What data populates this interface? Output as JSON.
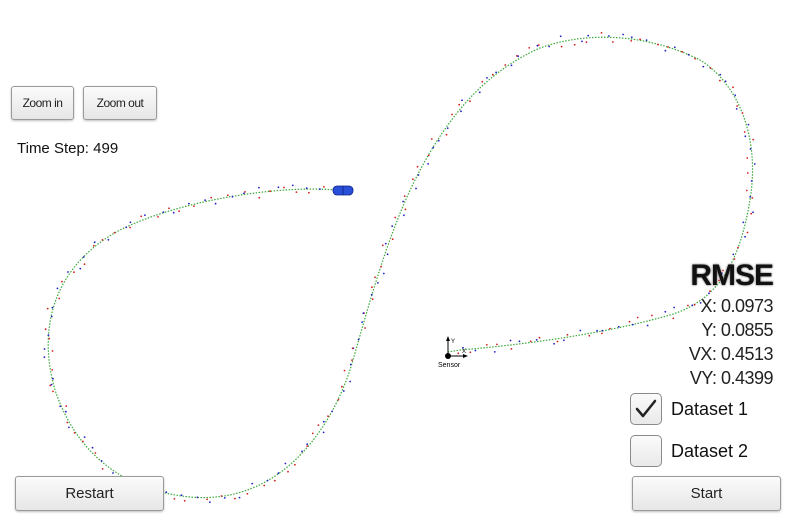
{
  "controls": {
    "zoom_in_label": "Zoom in",
    "zoom_out_label": "Zoom out",
    "restart_label": "Restart",
    "start_label": "Start"
  },
  "status": {
    "time_step_label": "Time Step: 499"
  },
  "rmse": {
    "title": "RMSE",
    "x": "X: 0.0973",
    "y": "Y: 0.0855",
    "vx": "VX: 0.4513",
    "vy": "VY: 0.4399"
  },
  "datasets": [
    {
      "label": "Dataset 1",
      "checked": true
    },
    {
      "label": "Dataset 2",
      "checked": false
    }
  ],
  "sensor": {
    "label": "Sensor",
    "axis_y": "Y",
    "axis_x": "X"
  },
  "colors": {
    "track": "#3aa83a",
    "lidar": "#d62020",
    "radar": "#2020c8",
    "car": "#2a4fd8",
    "background": "#ffffff"
  }
}
